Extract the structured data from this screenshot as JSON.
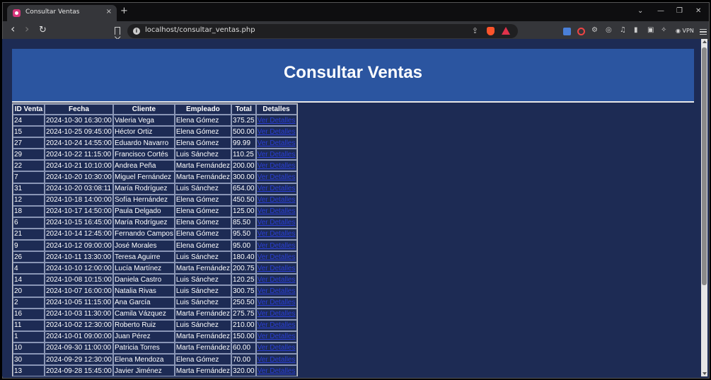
{
  "browser": {
    "tab_title": "Consultar Ventas",
    "tab_close": "×",
    "new_tab": "+",
    "url": "localhost/consultar_ventas.php",
    "vpn_label": "VPN",
    "nav_back": "‹",
    "nav_forward": "›",
    "reload": "↻",
    "win_min": "—",
    "win_max": "❐",
    "win_close": "✕",
    "tab_list": "⌄"
  },
  "page": {
    "title": "Consultar Ventas",
    "columns": [
      "ID Venta",
      "Fecha",
      "Cliente",
      "Empleado",
      "Total",
      "Detalles"
    ],
    "link_label": "Ver Detalles",
    "rows": [
      [
        "24",
        "2024-10-30 16:30:00",
        "Valeria Vega",
        "Elena Gómez",
        "375.25"
      ],
      [
        "15",
        "2024-10-25 09:45:00",
        "Héctor Ortiz",
        "Elena Gómez",
        "500.00"
      ],
      [
        "27",
        "2024-10-24 14:55:00",
        "Eduardo Navarro",
        "Elena Gómez",
        "99.99"
      ],
      [
        "29",
        "2024-10-22 11:15:00",
        "Francisco Cortés",
        "Luis Sánchez",
        "110.25"
      ],
      [
        "22",
        "2024-10-21 10:10:00",
        "Andrea Peña",
        "Marta Fernández",
        "200.00"
      ],
      [
        "7",
        "2024-10-20 10:30:00",
        "Miguel Fernández",
        "Marta Fernández",
        "300.00"
      ],
      [
        "31",
        "2024-10-20 03:08:11",
        "María Rodríguez",
        "Luis Sánchez",
        "654.00"
      ],
      [
        "12",
        "2024-10-18 14:00:00",
        "Sofía Hernández",
        "Elena Gómez",
        "450.50"
      ],
      [
        "18",
        "2024-10-17 14:50:00",
        "Paula Delgado",
        "Elena Gómez",
        "125.00"
      ],
      [
        "6",
        "2024-10-15 16:45:00",
        "María Rodríguez",
        "Elena Gómez",
        "85.50"
      ],
      [
        "21",
        "2024-10-14 12:45:00",
        "Fernando Campos",
        "Elena Gómez",
        "95.50"
      ],
      [
        "9",
        "2024-10-12 09:00:00",
        "José Morales",
        "Elena Gómez",
        "95.00"
      ],
      [
        "26",
        "2024-10-11 13:30:00",
        "Teresa Aguirre",
        "Luis Sánchez",
        "180.40"
      ],
      [
        "4",
        "2024-10-10 12:00:00",
        "Lucía Martínez",
        "Marta Fernández",
        "200.75"
      ],
      [
        "14",
        "2024-10-08 10:15:00",
        "Daniela Castro",
        "Luis Sánchez",
        "120.25"
      ],
      [
        "20",
        "2024-10-07 16:00:00",
        "Natalia Rivas",
        "Luis Sánchez",
        "300.75"
      ],
      [
        "2",
        "2024-10-05 11:15:00",
        "Ana García",
        "Luis Sánchez",
        "250.50"
      ],
      [
        "16",
        "2024-10-03 11:30:00",
        "Camila Vázquez",
        "Marta Fernández",
        "275.75"
      ],
      [
        "11",
        "2024-10-02 12:30:00",
        "Roberto Ruiz",
        "Luis Sánchez",
        "210.00"
      ],
      [
        "1",
        "2024-10-01 09:00:00",
        "Juan Pérez",
        "Marta Fernández",
        "150.00"
      ],
      [
        "10",
        "2024-09-30 11:00:00",
        "Patricia Torres",
        "Marta Fernández",
        "60.00"
      ],
      [
        "30",
        "2024-09-29 12:30:00",
        "Elena Mendoza",
        "Elena Gómez",
        "70.00"
      ],
      [
        "13",
        "2024-09-28 15:45:00",
        "Javier Jiménez",
        "Marta Fernández",
        "320.00"
      ]
    ]
  },
  "colors": {
    "page_bg": "#1d2b54",
    "header_band": "#2b55a0",
    "link": "#2a3fd6"
  }
}
